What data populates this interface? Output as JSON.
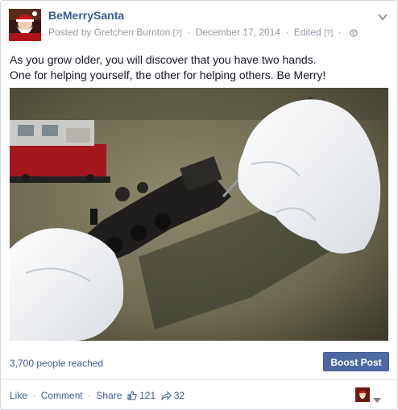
{
  "post": {
    "page_name": "BeMerrySanta",
    "byline": {
      "posted_by": "Posted by Gretchen Burnton",
      "posted_by_help": "[?]",
      "date": "December 17, 2014",
      "edited": "Edited",
      "edited_help": "[?]",
      "separator": "·",
      "audience_icon": "globe-icon"
    },
    "options_icon": "chevron-down-icon",
    "text_line1": "As you grow older, you will discover that you have two hands.",
    "text_line2": "One for helping yourself, the other for helping others. Be Merry!",
    "photo_subject": "white-gloved hands repairing a model steam locomotive"
  },
  "insights": {
    "reach": "3,700 people reached",
    "boost_label": "Boost Post"
  },
  "actions": {
    "like": "Like",
    "comment": "Comment",
    "share": "Share",
    "separator": "·",
    "like_count": "121",
    "share_count": "32",
    "like_icon": "thumbs-up-icon",
    "share_icon": "share-arrow-icon"
  },
  "colors": {
    "link": "#3b5998",
    "meta": "#9197a3",
    "boost_bg": "#4e69a2",
    "text": "#141823"
  }
}
